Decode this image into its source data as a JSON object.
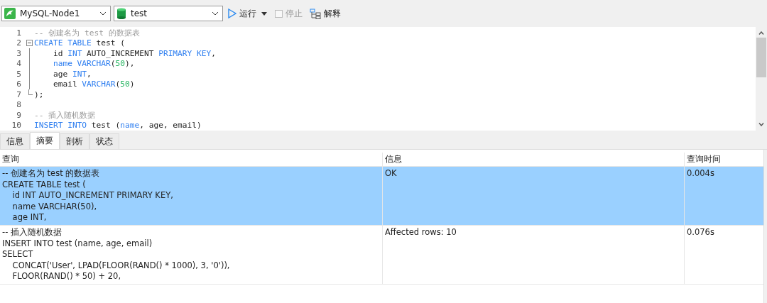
{
  "toolbar": {
    "connection": "MySQL-Node1",
    "database": "test",
    "run": "运行",
    "stop": {
      "label": "停止",
      "disabled": true
    },
    "explain": "解释"
  },
  "editor": {
    "lines": [
      {
        "number": "1",
        "kind": "plain",
        "tokens": [
          {
            "t": "-- 创建名为 test 的数据表",
            "kind": "comment"
          }
        ]
      },
      {
        "number": "2",
        "kind": "foldstart",
        "tokens": [
          {
            "t": "CREATE TABLE",
            "kind": "keyword"
          },
          {
            "t": " test (",
            "kind": "plain"
          }
        ]
      },
      {
        "number": "3",
        "kind": "foldbody",
        "indent": true,
        "tokens": [
          {
            "t": "id ",
            "kind": "plain"
          },
          {
            "t": "INT",
            "kind": "keyword"
          },
          {
            "t": " AUTO_INCREMENT ",
            "kind": "plain"
          },
          {
            "t": "PRIMARY KEY",
            "kind": "keyword"
          },
          {
            "t": ",",
            "kind": "plain"
          }
        ]
      },
      {
        "number": "4",
        "kind": "foldbody",
        "indent": true,
        "tokens": [
          {
            "t": "name VARCHAR",
            "kind": "keyword"
          },
          {
            "t": "(",
            "kind": "plain"
          },
          {
            "t": "50",
            "kind": "number"
          },
          {
            "t": "),",
            "kind": "plain"
          }
        ]
      },
      {
        "number": "5",
        "kind": "foldbody",
        "indent": true,
        "tokens": [
          {
            "t": "age ",
            "kind": "plain"
          },
          {
            "t": "INT",
            "kind": "keyword"
          },
          {
            "t": ",",
            "kind": "plain"
          }
        ]
      },
      {
        "number": "6",
        "kind": "foldbody",
        "indent": true,
        "tokens": [
          {
            "t": "email ",
            "kind": "plain"
          },
          {
            "t": "VARCHAR",
            "kind": "keyword"
          },
          {
            "t": "(",
            "kind": "plain"
          },
          {
            "t": "50",
            "kind": "number"
          },
          {
            "t": ")",
            "kind": "plain"
          }
        ]
      },
      {
        "number": "7",
        "kind": "foldend",
        "tokens": [
          {
            "t": ");",
            "kind": "plain"
          }
        ]
      },
      {
        "number": "8",
        "kind": "plain"
      },
      {
        "number": "9",
        "kind": "plain",
        "tokens": [
          {
            "t": "-- 插入随机数据",
            "kind": "comment"
          }
        ]
      },
      {
        "number": "10",
        "kind": "plain",
        "tokens": [
          {
            "t": "INSERT INTO",
            "kind": "keyword"
          },
          {
            "t": " test (",
            "kind": "plain"
          },
          {
            "t": "name",
            "kind": "keyword"
          },
          {
            "t": ", age, email)",
            "kind": "plain"
          }
        ]
      }
    ]
  },
  "tabs": [
    {
      "label": "信息",
      "selected": false
    },
    {
      "label": "摘要",
      "selected": true
    },
    {
      "label": "剖析",
      "selected": false
    },
    {
      "label": "状态",
      "selected": false
    }
  ],
  "results": {
    "columns": [
      "查询",
      "信息",
      "查询时间"
    ],
    "rows": [
      {
        "selected": true,
        "query": [
          "-- 创建名为 test 的数据表",
          "CREATE TABLE test (",
          "    id INT AUTO_INCREMENT PRIMARY KEY,",
          "    name VARCHAR(50),",
          "    age INT,"
        ],
        "info": "OK",
        "time": "0.004s"
      },
      {
        "selected": false,
        "query": [
          "-- 插入随机数据",
          "INSERT INTO test (name, age, email)",
          "SELECT",
          "    CONCAT('User', LPAD(FLOOR(RAND() * 1000), 3, '0')),",
          "    FLOOR(RAND() * 50) + 20,"
        ],
        "info": "Affected rows: 10",
        "time": "0.076s"
      }
    ]
  }
}
